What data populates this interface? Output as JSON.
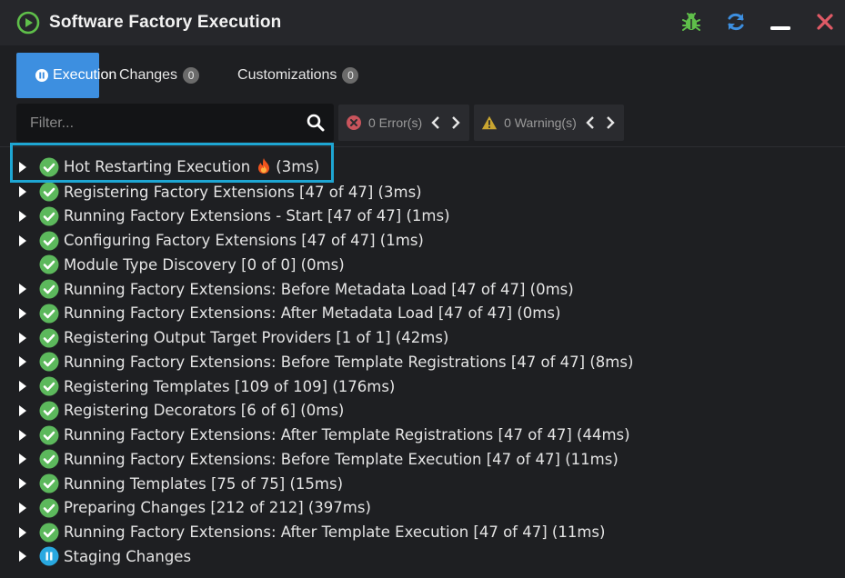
{
  "window": {
    "title": "Software Factory Execution",
    "actions": [
      {
        "icon": "bug-icon",
        "color": "#5fbf4a"
      },
      {
        "icon": "refresh-icon",
        "color": "#3d8fe0"
      },
      {
        "icon": "minimize-icon",
        "color": "#ffffff"
      },
      {
        "icon": "close-icon",
        "color": "#e05a66"
      }
    ]
  },
  "tabs": [
    {
      "label": "Execution",
      "active": true,
      "icon": "pause-circle-icon"
    },
    {
      "label": "Changes",
      "count": "0",
      "active": false
    },
    {
      "label": "Customizations",
      "count": "0",
      "active": false
    }
  ],
  "filter": {
    "placeholder": "Filter...",
    "value": ""
  },
  "errors": {
    "label": "0 Error(s)",
    "icon": "error-circle-icon"
  },
  "warnings": {
    "label": "0 Warning(s)",
    "icon": "warning-triangle-icon"
  },
  "colors": {
    "accent": "#3d8fe0",
    "success": "#5cb85c",
    "highlight": "#1ea6d3",
    "running": "#29a8e0"
  },
  "tree": [
    {
      "label": "Hot Restarting Execution",
      "suffix": "(3ms)",
      "fire": true,
      "status": "success",
      "expandable": true,
      "highlighted": true
    },
    {
      "label": "Registering Factory Extensions [47 of 47] (3ms)",
      "status": "success",
      "expandable": true
    },
    {
      "label": "Running Factory Extensions - Start [47 of 47] (1ms)",
      "status": "success",
      "expandable": true
    },
    {
      "label": "Configuring Factory Extensions [47 of 47] (1ms)",
      "status": "success",
      "expandable": true
    },
    {
      "label": "Module Type Discovery [0 of 0] (0ms)",
      "status": "success",
      "expandable": false
    },
    {
      "label": "Running Factory Extensions: Before Metadata Load [47 of 47] (0ms)",
      "status": "success",
      "expandable": true
    },
    {
      "label": "Running Factory Extensions: After Metadata Load [47 of 47] (0ms)",
      "status": "success",
      "expandable": true
    },
    {
      "label": "Registering Output Target Providers [1 of 1] (42ms)",
      "status": "success",
      "expandable": true
    },
    {
      "label": "Running Factory Extensions: Before Template Registrations [47 of 47] (8ms)",
      "status": "success",
      "expandable": true
    },
    {
      "label": "Registering Templates [109 of 109] (176ms)",
      "status": "success",
      "expandable": true
    },
    {
      "label": "Registering Decorators [6 of 6] (0ms)",
      "status": "success",
      "expandable": true
    },
    {
      "label": "Running Factory Extensions: After Template Registrations [47 of 47] (44ms)",
      "status": "success",
      "expandable": true
    },
    {
      "label": "Running Factory Extensions: Before Template Execution [47 of 47] (11ms)",
      "status": "success",
      "expandable": true
    },
    {
      "label": "Running Templates [75 of 75] (15ms)",
      "status": "success",
      "expandable": true
    },
    {
      "label": "Preparing Changes [212 of 212] (397ms)",
      "status": "success",
      "expandable": true
    },
    {
      "label": "Running Factory Extensions: After Template Execution [47 of 47] (11ms)",
      "status": "success",
      "expandable": true
    },
    {
      "label": "Staging Changes",
      "status": "running",
      "expandable": true
    }
  ]
}
